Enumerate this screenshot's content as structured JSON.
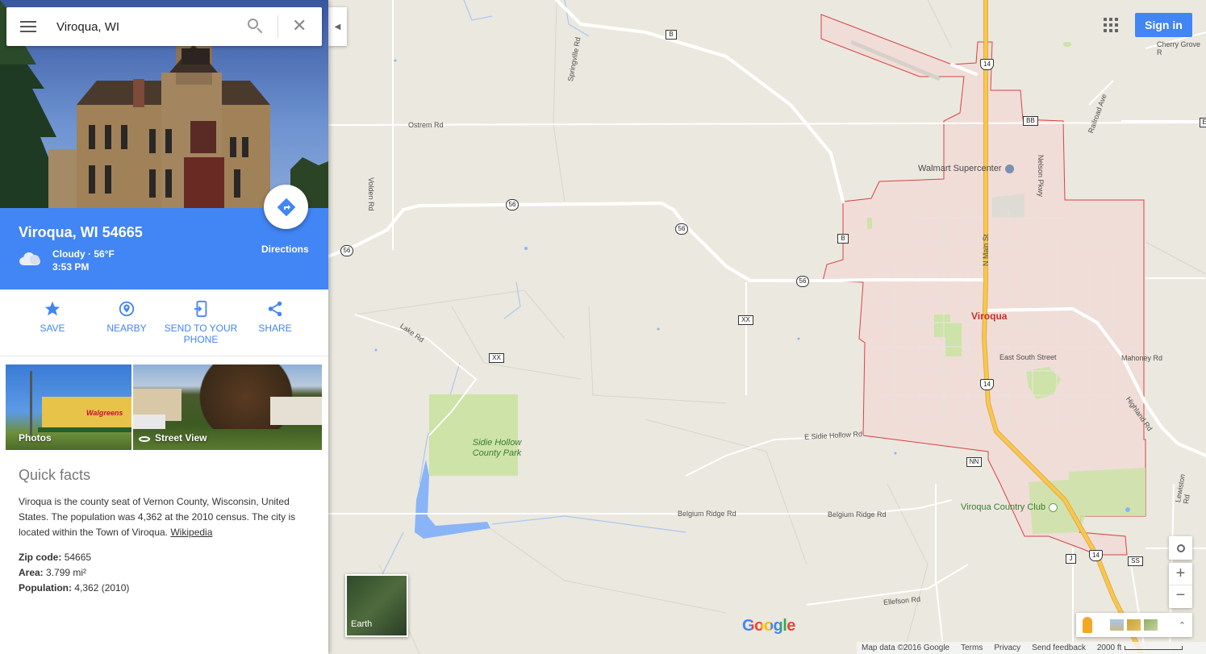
{
  "search": {
    "value": "Viroqua, WI"
  },
  "place": {
    "title": "Viroqua, WI 54665",
    "weather": "Cloudy · 56°F",
    "time": "3:53 PM",
    "directions_label": "Directions"
  },
  "actions": [
    {
      "label": "SAVE",
      "icon": "star-icon"
    },
    {
      "label": "NEARBY",
      "icon": "place-pin-icon"
    },
    {
      "label": "SEND TO YOUR PHONE",
      "icon": "phone-send-icon"
    },
    {
      "label": "SHARE",
      "icon": "share-icon"
    }
  ],
  "photos": {
    "photos_label": "Photos",
    "street_view_label": "Street View",
    "store_sign": "Walgreens"
  },
  "quick_facts": {
    "heading": "Quick facts",
    "description": "Viroqua is the county seat of Vernon County, Wisconsin, United States. The population was 4,362 at the 2010 census. The city is located within the Town of Viroqua.",
    "source_link": "Wikipedia",
    "facts": [
      {
        "label": "Zip code:",
        "value": "54665"
      },
      {
        "label": "Area:",
        "value": "3.799 mi²"
      },
      {
        "label": "Population:",
        "value": "4,362 (2010)"
      }
    ]
  },
  "map": {
    "city_label": "Viroqua",
    "roads": {
      "ostrem": "Ostrem Rd",
      "volden": "Volden Rd",
      "springville": "Springville Rd",
      "lake": "Lake Rd",
      "n_main": "N Main St",
      "nelson": "Nelson Pkwy",
      "east_south": "East South Street",
      "mahoney": "Mahoney Rd",
      "highland": "Highland Rd",
      "sidie_hollow": "E Sidie Hollow Rd",
      "belgium_1": "Belgium Ridge Rd",
      "belgium_2": "Belgium Ridge Rd",
      "ellefson": "Ellefson Rd",
      "lewiston": "Lewiston Rd",
      "railroad": "Railroad Ave",
      "cherry_grove": "Cherry Grove R"
    },
    "shields": {
      "b_top": "B",
      "r56_a": "56",
      "r56_b": "56",
      "r56_c": "56",
      "r56_d": "56",
      "xx_a": "XX",
      "xx_b": "XX",
      "b_mid": "B",
      "bb": "BB",
      "us14_a": "14",
      "us14_b": "14",
      "us14_c": "14",
      "nn": "NN",
      "j": "J",
      "ss": "SS",
      "e_edge": "E"
    },
    "pois": {
      "walmart": "Walmart Supercenter",
      "park": "Sidie Hollow County Park",
      "country_club": "Viroqua Country Club"
    },
    "earth_label": "Earth",
    "sign_in": "Sign in",
    "google_logo": "Google",
    "footer": {
      "data": "Map data ©2016 Google",
      "terms": "Terms",
      "privacy": "Privacy",
      "feedback": "Send feedback",
      "scale": "2000 ft"
    },
    "colors": {
      "city_fill": "#f2d9d5",
      "city_border": "#d64545",
      "highway": "#f6c94a",
      "park": "#cde3a8",
      "water": "#8ab4f8",
      "land": "#ebe8df"
    }
  }
}
